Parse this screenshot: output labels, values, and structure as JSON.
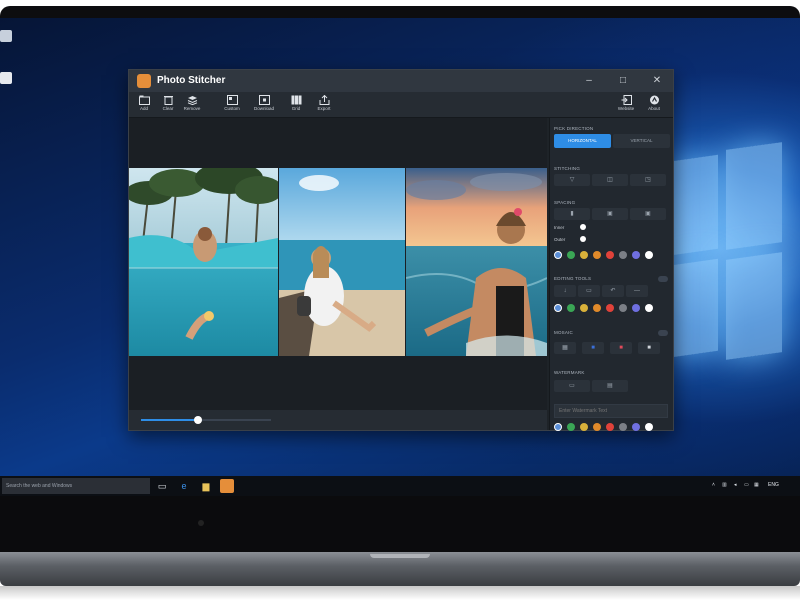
{
  "app": {
    "title": "Photo Stitcher",
    "window_controls": {
      "minimize": "–",
      "maximize": "□",
      "close": "✕"
    }
  },
  "toolbar": {
    "items": [
      {
        "label": "Add"
      },
      {
        "label": "Clear"
      },
      {
        "label": "Remove"
      },
      {
        "label": "Custom"
      },
      {
        "label": "Download"
      },
      {
        "label": "Grid"
      },
      {
        "label": "Export"
      }
    ],
    "right": [
      {
        "label": "Website"
      },
      {
        "label": "About"
      }
    ]
  },
  "panel": {
    "direction": {
      "title": "PICK DIRECTION",
      "horizontal": "HORIZONTAL",
      "vertical": "VERTICAL",
      "selected": "HORIZONTAL"
    },
    "stitching": {
      "title": "STITCHING"
    },
    "spacing": {
      "title": "SPACING",
      "inner_label": "Inner",
      "outer_label": "Outer"
    },
    "editing": {
      "title": "EDITING TOOLS"
    },
    "mosaic": {
      "title": "MOSAIC"
    },
    "watermark": {
      "title": "WATERMARK",
      "placeholder": "Enter Watermark Text"
    }
  },
  "colors": {
    "swatches": [
      "#5b8fd8",
      "#3aa655",
      "#d9b13a",
      "#e08a2a",
      "#e0423a",
      "#7b7f86",
      "#6f6fe0",
      "#ffffff"
    ],
    "accent": "#2e8de6",
    "panel_bg": "#22282f"
  },
  "slider": {
    "value": 0.44
  },
  "taskbar": {
    "search_placeholder": "Search the web and Windows",
    "tray_lang": "ENG"
  }
}
